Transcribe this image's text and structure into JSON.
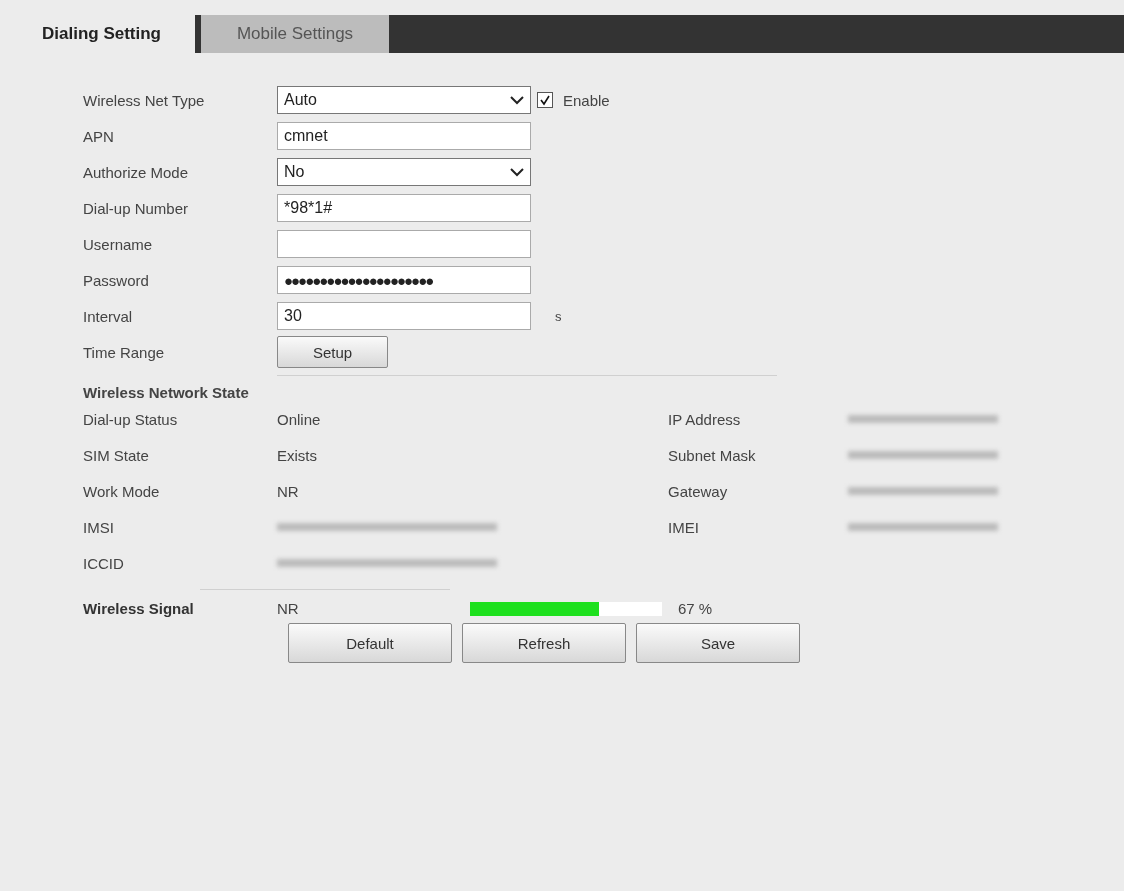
{
  "tabs": [
    {
      "label": "Dialing Setting",
      "selected": true
    },
    {
      "label": "Mobile Settings",
      "selected": false
    }
  ],
  "form": [
    {
      "kind": "select",
      "label": "Wireless Net Type",
      "value": "Auto",
      "checkbox": {
        "label": "Enable",
        "checked": true
      }
    },
    {
      "kind": "text",
      "label": "APN",
      "value": "cmnet"
    },
    {
      "kind": "select",
      "label": "Authorize Mode",
      "value": "No"
    },
    {
      "kind": "text",
      "label": "Dial-up Number",
      "value": "*98*1#"
    },
    {
      "kind": "text",
      "label": "Username"
    },
    {
      "kind": "password",
      "label": "Password",
      "value": "●●●●●●●●●●●●●●●●●●●●●"
    },
    {
      "kind": "text",
      "label": "Interval",
      "value": "30",
      "unit": "s"
    },
    {
      "kind": "button",
      "label": "Time Range",
      "value": "Setup"
    }
  ],
  "state": {
    "title": "Wireless Network State",
    "left": [
      {
        "label": "Dial-up Status",
        "value": "Online",
        "redacted": false
      },
      {
        "label": "SIM State",
        "value": "Exists",
        "redacted": false
      },
      {
        "label": "Work Mode",
        "value": "NR",
        "redacted": false
      },
      {
        "label": "IMSI",
        "redacted": true
      },
      {
        "label": "ICCID",
        "redacted": true
      }
    ],
    "right": [
      {
        "label": "IP Address",
        "redacted": true
      },
      {
        "label": "Subnet Mask",
        "redacted": true
      },
      {
        "label": "Gateway",
        "redacted": true
      },
      {
        "label": "IMEI",
        "redacted": true
      }
    ]
  },
  "signal": {
    "label": "Wireless Signal",
    "mode": "NR",
    "level": 0.67,
    "reading": "67 %"
  },
  "buttons": [
    "Default",
    "Refresh",
    "Save"
  ]
}
